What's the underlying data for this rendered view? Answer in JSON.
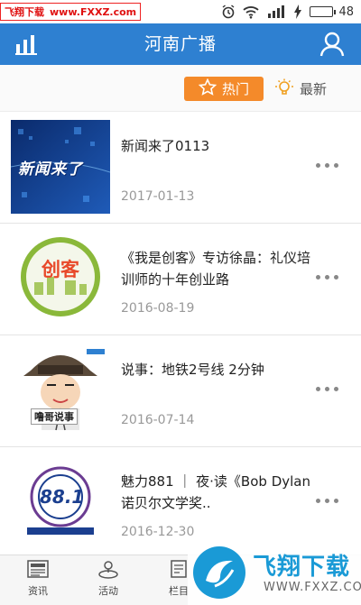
{
  "status_bar": {
    "watermark_name": "飞翔下载",
    "watermark_url": "www.FXXZ.com",
    "battery_level": "48",
    "battery_fraction": 0.48
  },
  "app_bar": {
    "title": "河南广播",
    "left_icon": "bar-chart-icon",
    "right_icon": "user-icon",
    "color": "#2e80d1"
  },
  "sort": {
    "hot_label": "热门",
    "latest_label": "最新",
    "hot_color": "#f48a2a"
  },
  "items": [
    {
      "title": "新闻来了0113",
      "date": "2017-01-13",
      "thumb_text": "新闻来了"
    },
    {
      "title": "《我是创客》专访徐晶：礼仪培训师的十年创业路",
      "date": "2016-08-19",
      "thumb_text": "创客"
    },
    {
      "title": "说事：地铁2号线 2分钟",
      "date": "2016-07-14",
      "thumb_text": "噜哥说事"
    },
    {
      "title": "魅力881 ｜ 夜·读《Bob Dylan 诺贝尔文学奖..",
      "date": "2016-12-30",
      "thumb_text": "88.1"
    }
  ],
  "bottom_nav": [
    {
      "label": "资讯",
      "icon": "news-icon"
    },
    {
      "label": "活动",
      "icon": "activity-icon"
    },
    {
      "label": "栏目",
      "icon": "column-icon"
    }
  ],
  "corner_watermark": {
    "title": "飞翔下载",
    "url": "WWW.FXXZ.COM"
  }
}
